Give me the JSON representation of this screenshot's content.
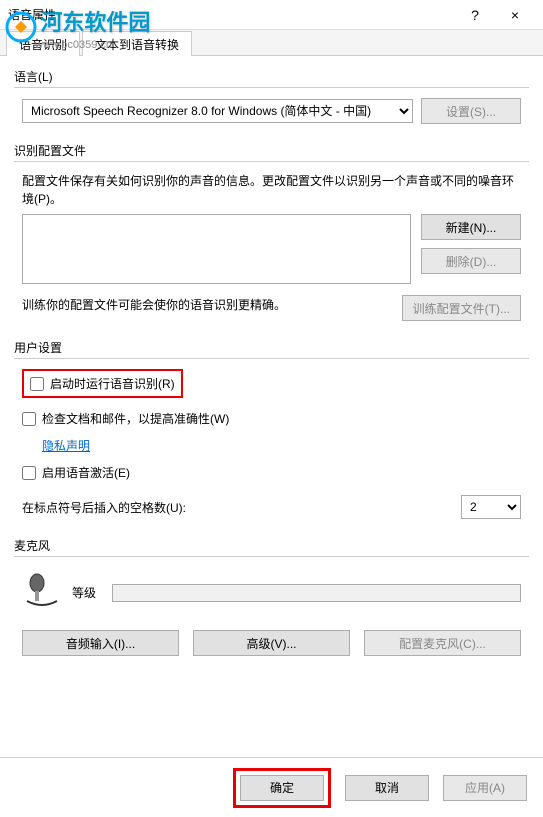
{
  "window": {
    "title": "语音属性",
    "close": "×",
    "help": "?"
  },
  "watermark": {
    "line1": "河东软件园",
    "line2": "www.pc0359.cn"
  },
  "tabs": {
    "tab1": "语音识别",
    "tab2": "文本到语音转换"
  },
  "language_section": {
    "label": "语言(L)",
    "selected": "Microsoft Speech Recognizer 8.0 for Windows (简体中文 - 中国)",
    "settings_btn": "设置(S)..."
  },
  "profile_section": {
    "label": "识别配置文件",
    "desc": "配置文件保存有关如何识别你的声音的信息。更改配置文件以识别另一个声音或不同的噪音环境(P)。",
    "new_btn": "新建(N)...",
    "delete_btn": "删除(D)...",
    "train_desc": "训练你的配置文件可能会使你的语音识别更精确。",
    "train_btn": "训练配置文件(T)..."
  },
  "user_section": {
    "label": "用户设置",
    "checkbox_startup": "启动时运行语音识别(R)",
    "checkbox_review": "检查文档和邮件，以提高准确性(W)",
    "privacy_link": "隐私声明",
    "checkbox_voice": "启用语音激活(E)",
    "spaces_label": "在标点符号后插入的空格数(U):",
    "spaces_value": "2"
  },
  "mic_section": {
    "label": "麦克风",
    "level_label": "等级",
    "audio_btn": "音频输入(I)...",
    "advanced_btn": "高级(V)...",
    "config_btn": "配置麦克风(C)..."
  },
  "bottom": {
    "ok": "确定",
    "cancel": "取消",
    "apply": "应用(A)"
  }
}
